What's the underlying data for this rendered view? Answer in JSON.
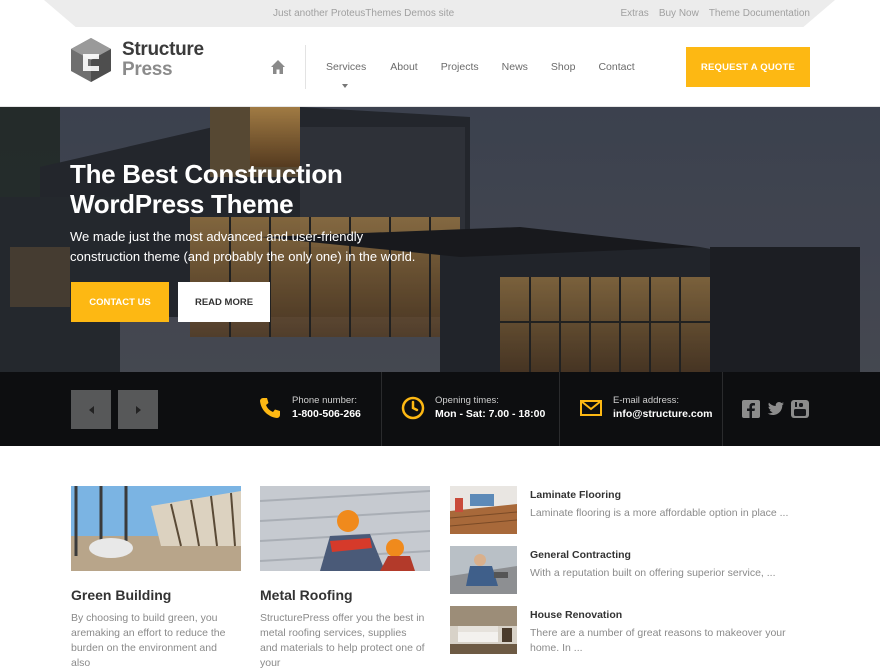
{
  "topbar": {
    "tagline": "Just another ProteusThemes Demos site",
    "links": [
      "Extras",
      "Buy Now",
      "Theme Documentation"
    ]
  },
  "header": {
    "logo_line1": "Structure",
    "logo_line2": "Press",
    "nav": [
      "Services",
      "About",
      "Projects",
      "News",
      "Shop",
      "Contact"
    ],
    "quote_button": "REQUEST A QUOTE"
  },
  "hero": {
    "title": "The Best Construction WordPress Theme",
    "subtitle": "We made just the most advanced and user-friendly construction theme (and probably the only one) in the world.",
    "contact_button": "CONTACT US",
    "read_button": "READ MORE"
  },
  "info": {
    "phone_label": "Phone number:",
    "phone_value": "1-800-506-266",
    "hours_label": "Opening times:",
    "hours_value": "Mon - Sat: 7.00 - 18:00",
    "email_label": "E-mail address:",
    "email_value": "info@structure.com"
  },
  "social_icons": [
    "facebook-icon",
    "twitter-icon",
    "youtube-icon"
  ],
  "cards": [
    {
      "title": "Green Building",
      "text": "By choosing to build  green, you aremaking an effort to reduce the burden on the environment and also"
    },
    {
      "title": "Metal Roofing",
      "text": "StructurePress offer you the best in metal roofing services, supplies and materials to help protect one of your"
    }
  ],
  "services": [
    {
      "title": "Laminate Flooring",
      "text": "Laminate flooring is a more affordable option in place ..."
    },
    {
      "title": "General Contracting",
      "text": "With a reputation built on offering superior service, ..."
    },
    {
      "title": "House Renovation",
      "text": "There are a number of great reasons to makeover your home. In ..."
    }
  ],
  "colors": {
    "accent": "#fdb813",
    "heading": "#333333",
    "muted": "#8a8a8a"
  }
}
